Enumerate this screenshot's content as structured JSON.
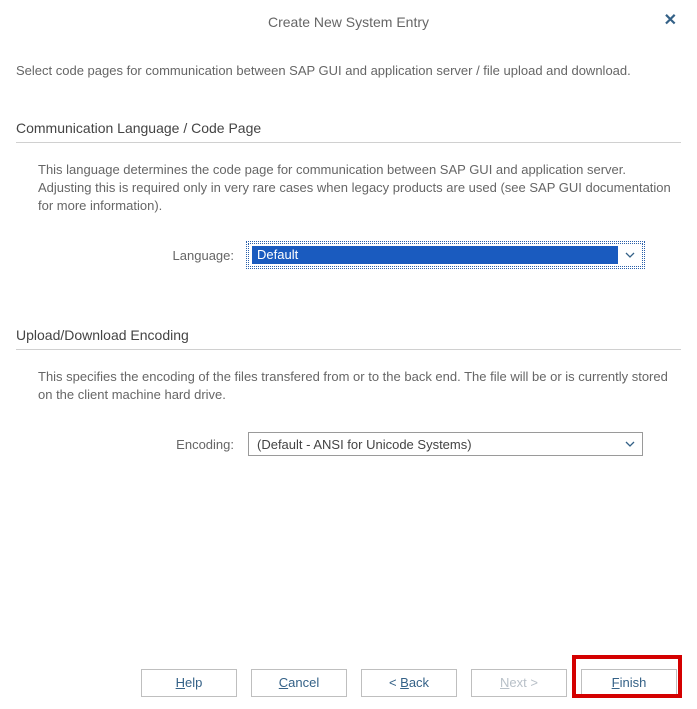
{
  "header": {
    "title": "Create New System Entry"
  },
  "intro": "Select code pages for communication between SAP GUI and application server / file upload and download.",
  "section1": {
    "title": "Communication Language / Code Page",
    "desc": "This language determines the code page for communication between SAP GUI and application server. Adjusting this is required only in very rare cases when legacy products are used (see SAP GUI documentation for more information).",
    "label": "Language:",
    "value": "Default"
  },
  "section2": {
    "title": "Upload/Download Encoding",
    "desc": "This specifies the encoding of the files transfered from or to the back end. The file will be or is currently stored on the client machine hard drive.",
    "label": "Encoding:",
    "value": "(Default - ANSI for Unicode Systems)"
  },
  "buttons": {
    "help_pre": "",
    "help_mn": "H",
    "help_post": "elp",
    "cancel_pre": "",
    "cancel_mn": "C",
    "cancel_post": "ancel",
    "back_pre": "< ",
    "back_mn": "B",
    "back_post": "ack",
    "next_pre": "",
    "next_mn": "N",
    "next_post": "ext >",
    "finish_pre": "",
    "finish_mn": "F",
    "finish_post": "inish"
  }
}
